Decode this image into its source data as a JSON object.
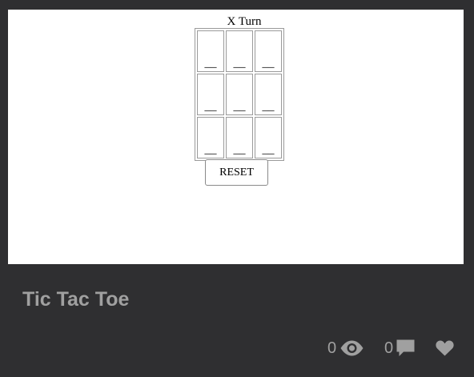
{
  "preview": {
    "turn_label": "X Turn",
    "board": [
      [
        "__",
        "__",
        "__"
      ],
      [
        "__",
        "__",
        "__"
      ],
      [
        "__",
        "__",
        "__"
      ]
    ],
    "reset_label": "RESET"
  },
  "card": {
    "title": "Tic Tac Toe",
    "views": "0",
    "comments": "0",
    "icons": {
      "views": "eye-icon",
      "comments": "comment-icon",
      "like": "heart-icon"
    },
    "icon_color": "#a0a0a0",
    "background_color": "#2f2f31"
  }
}
